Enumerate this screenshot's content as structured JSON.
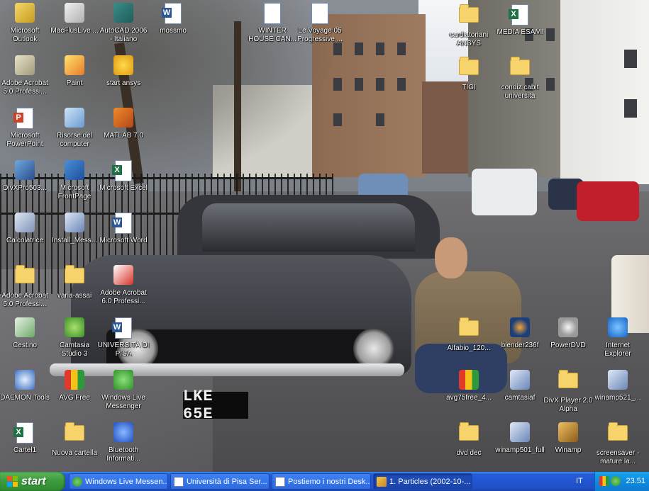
{
  "desktop": {
    "icons": [
      {
        "label": "Microsoft\nOutlook",
        "icon": "outlook-icon"
      },
      {
        "label": "MacFlusLive ...",
        "icon": "app-icon"
      },
      {
        "label": "AutoCAD 2006\n- Italiano",
        "icon": "autocad-icon"
      },
      {
        "label": "mossmo",
        "icon": "word-doc-icon"
      },
      {
        "label": "WINTER\nHOUSE CAN...",
        "icon": "document-icon"
      },
      {
        "label": "Le Voyage 05\nProgressive ...",
        "icon": "document-icon"
      },
      {
        "label": "cardiatoriani\nANSYS",
        "icon": "folder-icon"
      },
      {
        "label": "MEDIA ESAMI",
        "icon": "excel-icon"
      },
      {
        "label": "Adobe Acrobat\n5.0 Professi...",
        "icon": "acrobat-installer-icon"
      },
      {
        "label": "Paint",
        "icon": "paint-icon"
      },
      {
        "label": "start ansys",
        "icon": "ansys-icon"
      },
      {
        "label": "TIGI",
        "icon": "folder-icon"
      },
      {
        "label": "condiz cabit\nuniversita",
        "icon": "folder-icon"
      },
      {
        "label": "Microsoft\nPowerPoint",
        "icon": "powerpoint-icon"
      },
      {
        "label": "Risorse del\ncomputer",
        "icon": "my-computer-icon"
      },
      {
        "label": "MATLAB 7.0",
        "icon": "matlab-icon"
      },
      {
        "label": "DivXPro503...",
        "icon": "divx-icon"
      },
      {
        "label": "Microsoft\nFrontPage",
        "icon": "frontpage-icon"
      },
      {
        "label": "Microsoft Excel",
        "icon": "excel-icon"
      },
      {
        "label": "Calcolatrice",
        "icon": "calculator-icon"
      },
      {
        "label": "Install_Mess...",
        "icon": "installer-icon"
      },
      {
        "label": "Microsoft Word",
        "icon": "word-icon"
      },
      {
        "label": "Adobe Acrobat\n5.0 Professi...",
        "icon": "folder-icon"
      },
      {
        "label": "varia-assai",
        "icon": "folder-icon"
      },
      {
        "label": "Adobe Acrobat\n6.0 Professi...",
        "icon": "acrobat-icon"
      },
      {
        "label": "Cestino",
        "icon": "recycle-bin-icon"
      },
      {
        "label": "Camtasia\nStudio 3",
        "icon": "camtasia-icon"
      },
      {
        "label": "UNIVERSITÀ DI\nPISA",
        "icon": "word-doc-icon"
      },
      {
        "label": "Alfabio_120...",
        "icon": "folder-icon"
      },
      {
        "label": "blender236f",
        "icon": "blender-icon"
      },
      {
        "label": "PowerDVD",
        "icon": "powerdvd-icon"
      },
      {
        "label": "Internet\nExplorer",
        "icon": "internet-explorer-icon"
      },
      {
        "label": "DAEMON Tools",
        "icon": "daemon-tools-icon"
      },
      {
        "label": "AVG Free",
        "icon": "avg-icon"
      },
      {
        "label": "Windows Live\nMessenger",
        "icon": "messenger-icon"
      },
      {
        "label": "avg75free_4...",
        "icon": "avg-installer-icon"
      },
      {
        "label": "camtasiaf",
        "icon": "installer-icon"
      },
      {
        "label": "DivX Player 2.0\nAlpha",
        "icon": "folder-icon"
      },
      {
        "label": "winamp521_...",
        "icon": "installer-icon"
      },
      {
        "label": "Cartel1",
        "icon": "excel-icon"
      },
      {
        "label": "Nuova cartella",
        "icon": "folder-icon"
      },
      {
        "label": "Bluetooth\nInformati...",
        "icon": "bluetooth-icon"
      },
      {
        "label": "dvd dec",
        "icon": "folder-icon"
      },
      {
        "label": "winamp501_full",
        "icon": "installer-icon"
      },
      {
        "label": "Winamp",
        "icon": "winamp-icon"
      },
      {
        "label": "screensaver -\nmature la...",
        "icon": "folder-icon"
      }
    ],
    "wallpaper": {
      "plate_text": "LKE 65E"
    }
  },
  "taskbar": {
    "start_label": "start",
    "tasks": [
      {
        "label": "Windows Live Messen...",
        "icon": "messenger-icon",
        "active": false
      },
      {
        "label": "Università di Pisa Ser...",
        "icon": "document-icon",
        "active": false
      },
      {
        "label": "Postiemo i nostri Desk...",
        "icon": "document-icon",
        "active": false
      },
      {
        "label": "1. Particles (2002-10-...",
        "icon": "media-icon",
        "active": true
      }
    ],
    "tray": {
      "language": "IT",
      "clock": "23.51"
    }
  },
  "colors": {
    "taskbar_blue": "#245edb",
    "start_green": "#3c9c3c",
    "tray_blue": "#0f8be0"
  }
}
